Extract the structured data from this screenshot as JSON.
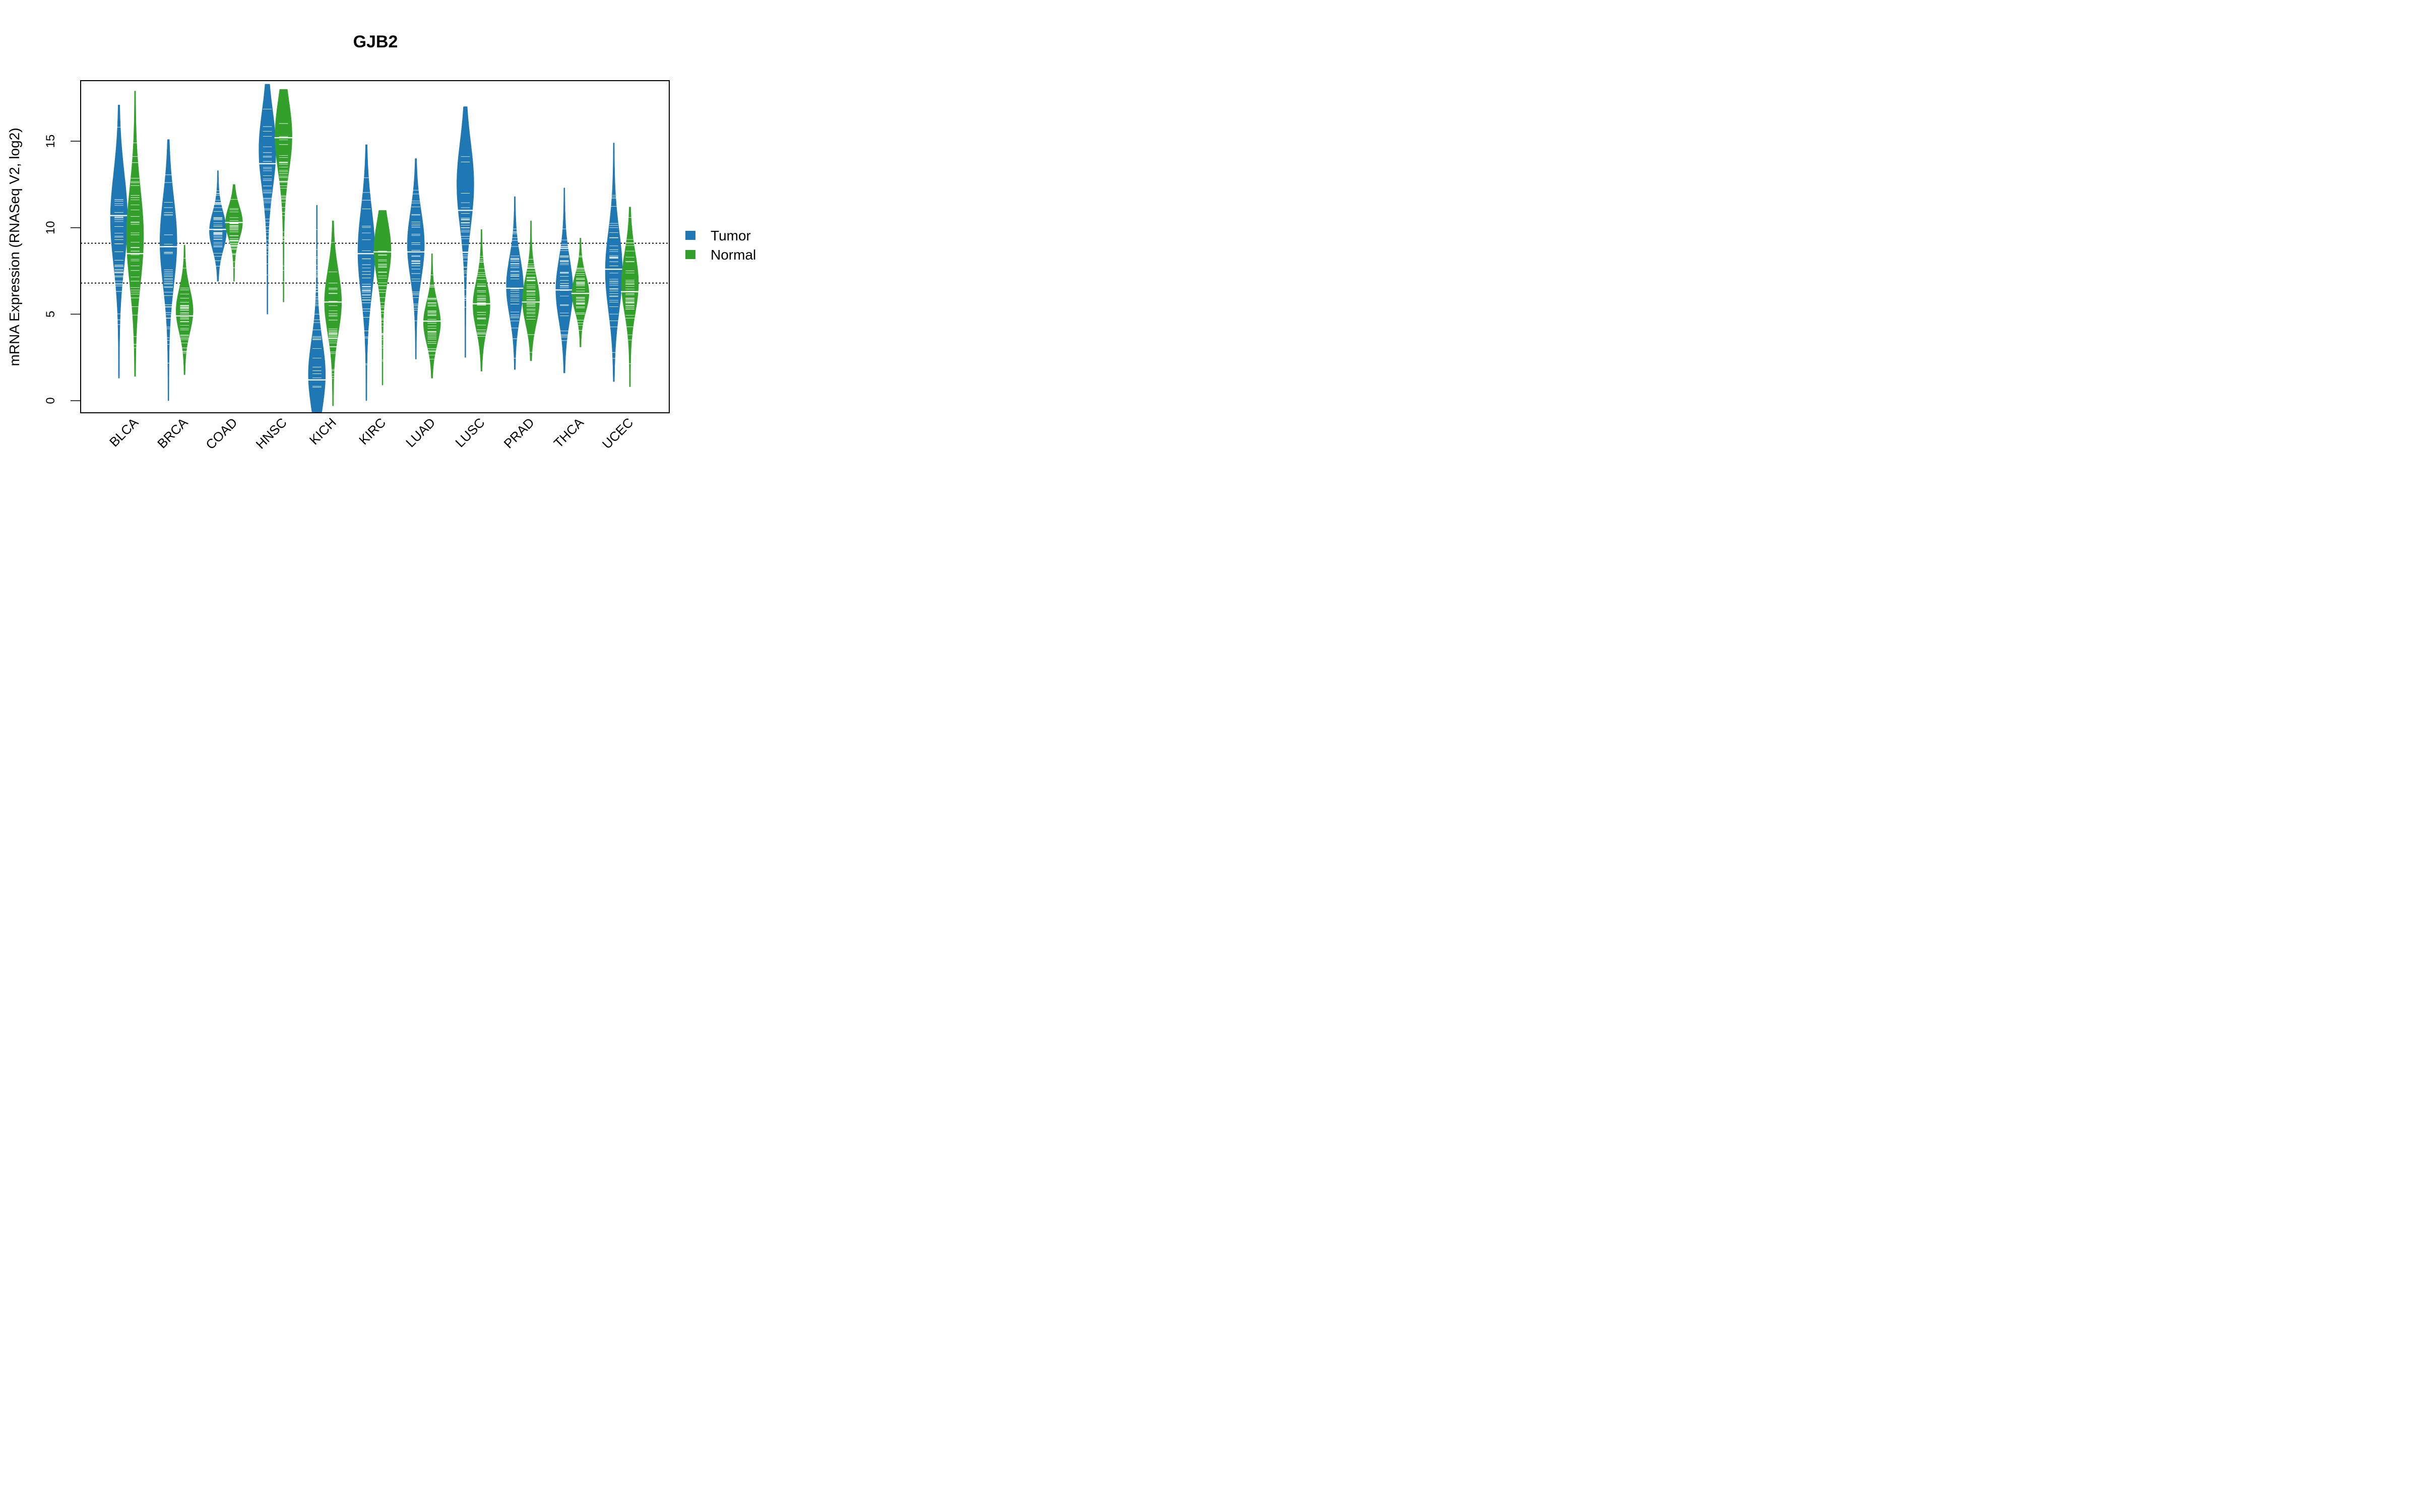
{
  "chart_data": {
    "type": "violin",
    "title": "GJB2",
    "xlabel": "",
    "ylabel": "mRNA Expression (RNASeq V2, log2)",
    "ylim": [
      -0.7,
      18.5
    ],
    "yticks": [
      0,
      5,
      10,
      15
    ],
    "grid": false,
    "reference_lines": [
      9.1,
      6.8
    ],
    "legend": {
      "placement": "right",
      "entries": [
        {
          "name": "Tumor",
          "color": "#1f77b4"
        },
        {
          "name": "Normal",
          "color": "#33a02c"
        }
      ]
    },
    "categories": [
      "BLCA",
      "BRCA",
      "COAD",
      "HNSC",
      "KICH",
      "KIRC",
      "LUAD",
      "LUSC",
      "PRAD",
      "THCA",
      "UCEC"
    ],
    "series": [
      {
        "name": "Tumor",
        "color": "#1f77b4",
        "values": [
          {
            "median": 10.7,
            "min": 1.3,
            "max": 17.1,
            "peak": 10.5
          },
          {
            "median": 8.9,
            "min": 0.0,
            "max": 15.1,
            "peak": 9.2
          },
          {
            "median": 9.9,
            "min": 6.9,
            "max": 13.3,
            "peak": 9.8
          },
          {
            "median": 13.7,
            "min": 5.0,
            "max": 18.3,
            "peak": 14.5
          },
          {
            "median": 1.2,
            "min": -0.7,
            "max": 11.3,
            "peak": 1.5
          },
          {
            "median": 8.5,
            "min": 0.0,
            "max": 14.8,
            "peak": 8.6
          },
          {
            "median": 8.6,
            "min": 2.4,
            "max": 14.0,
            "peak": 9.0
          },
          {
            "median": 11.0,
            "min": 2.5,
            "max": 17.0,
            "peak": 12.5
          },
          {
            "median": 6.5,
            "min": 1.8,
            "max": 11.8,
            "peak": 6.6
          },
          {
            "median": 6.4,
            "min": 1.6,
            "max": 12.3,
            "peak": 6.4
          },
          {
            "median": 7.6,
            "min": 1.1,
            "max": 14.9,
            "peak": 7.5
          }
        ]
      },
      {
        "name": "Normal",
        "color": "#33a02c",
        "values": [
          {
            "median": 8.5,
            "min": 1.4,
            "max": 17.9,
            "peak": 9.5
          },
          {
            "median": 4.9,
            "min": 1.5,
            "max": 9.0,
            "peak": 5.2
          },
          {
            "median": 10.3,
            "min": 6.9,
            "max": 12.5,
            "peak": 10.3
          },
          {
            "median": 15.2,
            "min": 5.7,
            "max": 18.0,
            "peak": 15.3
          },
          {
            "median": 5.7,
            "min": -0.3,
            "max": 10.4,
            "peak": 5.7
          },
          {
            "median": 8.6,
            "min": 0.9,
            "max": 11.0,
            "peak": 8.7
          },
          {
            "median": 4.6,
            "min": 1.3,
            "max": 8.5,
            "peak": 4.5
          },
          {
            "median": 5.6,
            "min": 1.7,
            "max": 9.9,
            "peak": 5.5
          },
          {
            "median": 5.7,
            "min": 2.3,
            "max": 10.4,
            "peak": 5.8
          },
          {
            "median": 6.2,
            "min": 3.1,
            "max": 9.4,
            "peak": 6.2
          },
          {
            "median": 6.3,
            "min": 0.8,
            "max": 11.2,
            "peak": 6.8
          }
        ]
      }
    ]
  }
}
